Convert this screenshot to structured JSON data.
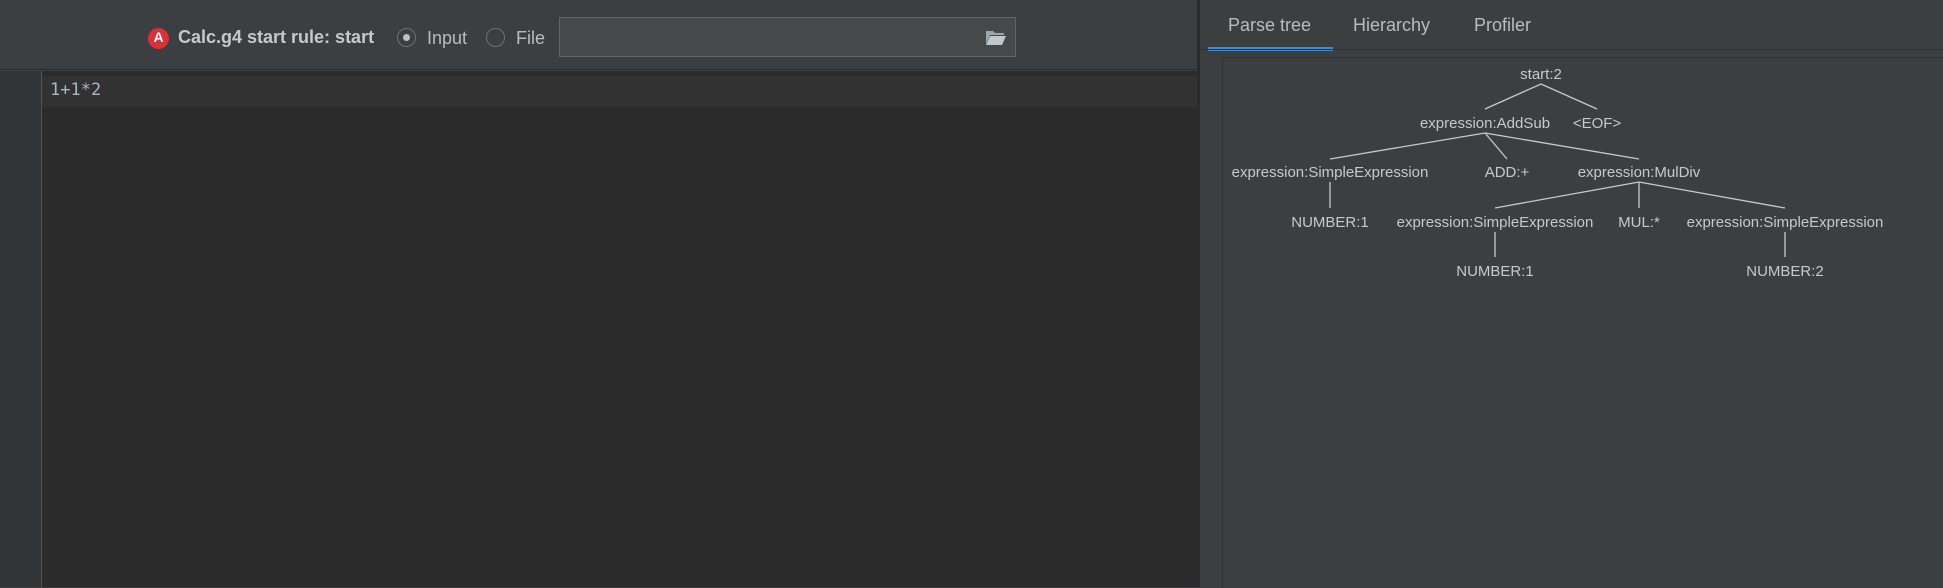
{
  "toolbar": {
    "grammar_rule_label": "Calc.g4 start rule: start",
    "antlr_icon_letter": "A",
    "input_mode_options": [
      "Input",
      "File"
    ],
    "selected_mode": "Input",
    "file_path_value": ""
  },
  "editor": {
    "lines": [
      "1+1*2"
    ]
  },
  "right_panel": {
    "tabs": [
      "Parse tree",
      "Hierarchy",
      "Profiler"
    ],
    "active_tab": "Parse tree"
  },
  "parse_tree": {
    "nodes": {
      "root": "start:2",
      "addsub": "expression:AddSub",
      "eof": "<EOF>",
      "simple1": "expression:SimpleExpression",
      "add": "ADD:+",
      "muldiv": "expression:MulDiv",
      "number1a": "NUMBER:1",
      "simple2": "expression:SimpleExpression",
      "mul": "MUL:*",
      "simple3": "expression:SimpleExpression",
      "number1b": "NUMBER:1",
      "number2": "NUMBER:2"
    }
  },
  "colors": {
    "background": "#3c3f41",
    "editor_background": "#2b2b2b",
    "accent": "#4a88c7",
    "antlr_red": "#d8313a"
  }
}
